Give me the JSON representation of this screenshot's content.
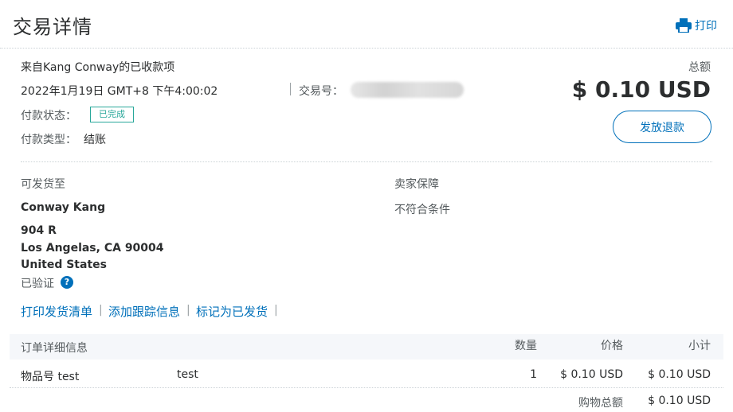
{
  "header": {
    "title": "交易详情",
    "print_label": "打印"
  },
  "transaction": {
    "from_label": "来自Kang Conway的已收款项",
    "datetime": "2022年1月19日 GMT+8 下午4:00:02",
    "txn_id_label": "交易号：",
    "status_label": "付款状态：",
    "status_value": "已完成",
    "type_label": "付款类型：",
    "type_value": "结账",
    "total_label": "总额",
    "total_amount": "$ 0.10 USD",
    "refund_button": "发放退款"
  },
  "shipping": {
    "heading": "可发货至",
    "name": "Conway Kang",
    "address_line1": "904 R",
    "address_line2": "Los Angelas, CA 90004",
    "country": "United States",
    "verified_label": "已验证",
    "verified_icon": "?"
  },
  "seller_protection": {
    "heading": "卖家保障",
    "value": "不符合条件"
  },
  "actions": {
    "print_packing_slip": "打印发货清单",
    "add_tracking": "添加跟踪信息",
    "mark_shipped": "标记为已发货",
    "separator": "|"
  },
  "order": {
    "header": {
      "details": "订单详细信息",
      "quantity": "数量",
      "price": "价格",
      "subtotal": "小计"
    },
    "items": [
      {
        "item_no": "物品号 test",
        "name": "test",
        "quantity": "1",
        "price": "$ 0.10 USD",
        "subtotal": "$ 0.10 USD"
      }
    ],
    "cart_total_label": "购物总额",
    "cart_total_value": "$ 0.10 USD"
  }
}
